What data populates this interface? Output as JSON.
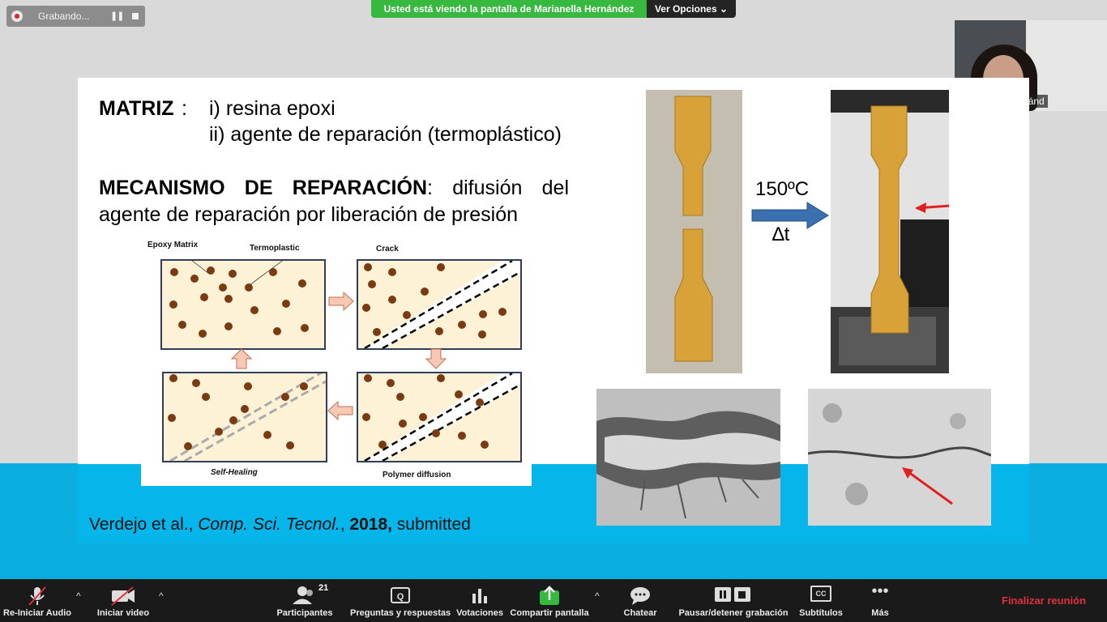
{
  "recording": {
    "label": "Grabando...",
    "pause_glyph": "❚❚"
  },
  "share_banner": {
    "text": "Usted está viendo la pantalla de Marianella Hernández",
    "options_label": "Ver Opciones",
    "options_caret": "⌄"
  },
  "video": {
    "name": "Marianella Hernánd"
  },
  "slide": {
    "matrix_title": "MATRIZ",
    "matrix_colon": ":",
    "matrix_item_1": "i) resina epoxi",
    "matrix_item_2": "ii) agente de reparación (termoplástico)",
    "mechanism_bold": "MECANISMO DE REPARACIÓN",
    "mechanism_rest_line1": ": difusión del",
    "mechanism_line2": "agente de reparación por liberación de presión",
    "diagram": {
      "label_epoxy": "Epoxy Matrix",
      "label_termoplastic": "Termoplastic",
      "label_crack": "Crack",
      "label_self_healing": "Self-Healing",
      "label_polymer_diffusion": "Polymer diffusion"
    },
    "temperature": "150ºC",
    "delta_t": "∆t",
    "citation": {
      "authors": "Verdejo et al., ",
      "journal": "Comp. Sci. Tecnol.",
      "sep": ", ",
      "year": "2018,",
      "status": " submitted"
    }
  },
  "toolbar": {
    "audio": "Re-Iniciar Audio",
    "video": "Iniciar video",
    "participants": "Participantes",
    "participants_count": "21",
    "qa": "Preguntas y respuestas",
    "polls": "Votaciones",
    "share": "Compartir pantalla",
    "chat": "Chatear",
    "recording": "Pausar/detener grabación",
    "subtitles": "Subtítulos",
    "cc_glyph": "CC",
    "more": "Más",
    "more_glyph": "•••",
    "end": "Finalizar reunión",
    "caret_glyph": "^"
  },
  "colors": {
    "share_green": "#37b83e",
    "end_red": "#e0303d",
    "accent_blue": "#06b6ea",
    "arrow_blue": "#3a6fb0",
    "arrow_red": "#e02020"
  }
}
